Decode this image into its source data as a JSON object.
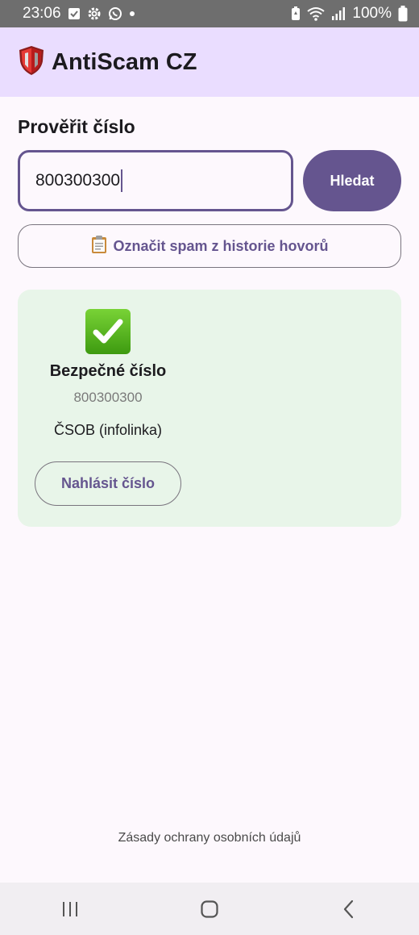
{
  "status_bar": {
    "time": "23:06",
    "battery": "100%",
    "icons": [
      "check-box-icon",
      "gear-icon",
      "whatsapp-icon",
      "dot-icon",
      "battery-saver-icon",
      "wifi-icon",
      "signal-icon",
      "battery-icon"
    ]
  },
  "app_bar": {
    "title": "AntiScam CZ",
    "logo_icon": "shield-icon"
  },
  "search": {
    "section_title": "Prověřit číslo",
    "input_value": "800300300",
    "button_label": "Hledat"
  },
  "history_button": {
    "icon": "clipboard-icon",
    "label": "Označit spam z historie hovorů"
  },
  "result": {
    "icon": "check-mark-icon",
    "title": "Bezpečné číslo",
    "number": "800300300",
    "name": "ČSOB (infolinka)",
    "report_label": "Nahlásit číslo"
  },
  "footer": {
    "privacy_label": "Zásady ochrany osobních údajů"
  },
  "nav_bar": {
    "icons": [
      "recent-apps-icon",
      "home-icon",
      "back-icon"
    ]
  },
  "colors": {
    "primary": "#65558f",
    "app_bar_bg": "#eaddff",
    "result_bg": "#e8f5e9",
    "status_bar_bg": "#6e6e6e"
  }
}
